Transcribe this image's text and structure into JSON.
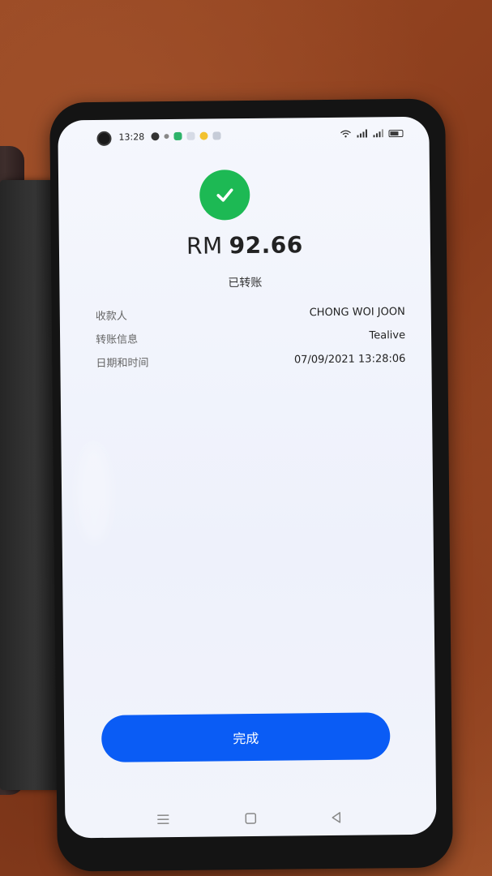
{
  "status_bar": {
    "time": "13:28"
  },
  "receipt": {
    "currency": "RM",
    "amount": "92.66",
    "status": "已转账",
    "details": [
      {
        "label": "收款人",
        "value": "CHONG WOI JOON"
      },
      {
        "label": "转账信息",
        "value": "Tealive"
      },
      {
        "label": "日期和时间",
        "value": "07/09/2021 13:28:06"
      }
    ],
    "done_label": "完成"
  },
  "colors": {
    "success": "#1db954",
    "primary_button": "#0a5cf5"
  },
  "icons": {
    "success": "check-icon",
    "nav_menu": "menu-icon",
    "nav_home": "home-square-icon",
    "nav_back": "back-triangle-icon"
  }
}
